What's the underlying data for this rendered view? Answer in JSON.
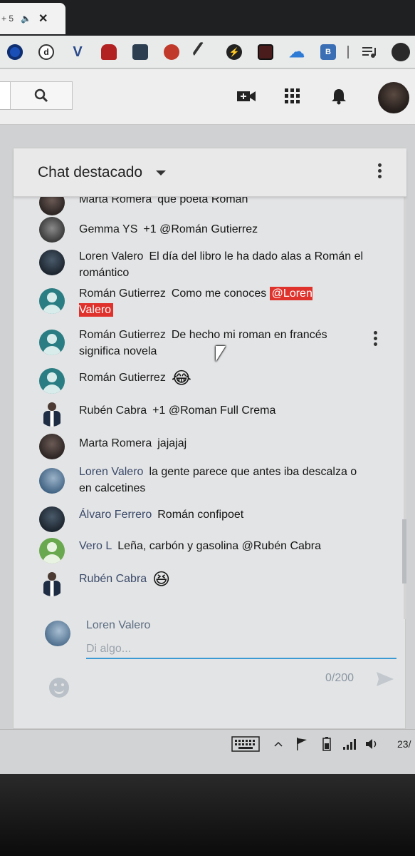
{
  "browser": {
    "tab": {
      "title": "+ 5",
      "sound_icon": "🔈",
      "close_icon": "✕"
    },
    "extensions": [
      {
        "name": "circle-blue-extension-icon",
        "label": "",
        "color": "#1a4fb8"
      },
      {
        "name": "d-extension-icon",
        "label": "d",
        "color": "#3a3a3a"
      },
      {
        "name": "v-extension-icon",
        "label": "V",
        "color": "#2b4b8a"
      },
      {
        "name": "lock-red-extension-icon",
        "label": "",
        "color": "#b22222"
      },
      {
        "name": "printer-extension-icon",
        "label": "",
        "color": "#2c3e50"
      },
      {
        "name": "bug-extension-icon",
        "label": "",
        "color": "#c0392b"
      },
      {
        "name": "pencil-extension-icon",
        "label": "",
        "color": "#333333"
      },
      {
        "name": "bolt-extension-icon",
        "label": "⚡",
        "color": "#222222"
      },
      {
        "name": "dark-square-extension-icon",
        "label": "",
        "color": "#4a1c1c"
      },
      {
        "name": "cloud-extension-icon",
        "label": "☁",
        "color": "#2e7bd6"
      },
      {
        "name": "b-extension-icon",
        "label": "B",
        "color": "#3b6fb5"
      },
      {
        "name": "playlist-extension-icon",
        "label": "",
        "color": "#333333"
      },
      {
        "name": "account-circle-icon",
        "label": "",
        "color": "#2a2a2a"
      }
    ]
  },
  "header": {
    "search_icon": "search-icon",
    "create_icon": "video-plus-icon",
    "apps_icon": "apps-grid-icon",
    "notifications_icon": "bell-icon"
  },
  "chat": {
    "title": "Chat destacado",
    "partial_top": {
      "author": "Marta Romera",
      "text": "que poeta Román"
    },
    "messages": [
      {
        "author": "Gemma YS",
        "text": "+1 @Román Gutierrez"
      },
      {
        "author": "Loren Valero",
        "text": "El día del libro le ha dado alas a Román el romántico"
      },
      {
        "author": "Román Gutierrez",
        "text": "Como me conoces ",
        "mention": "@Loren Valero"
      },
      {
        "author": "Román Gutierrez",
        "text": "De hecho mi roman en francés significa novela"
      },
      {
        "author": "Román Gutierrez",
        "text": "",
        "emoji": "😂"
      },
      {
        "author": "Rubén Cabra",
        "text": "+1 @Roman Full Crema"
      },
      {
        "author": "Marta Romera",
        "text": "jajajaj"
      },
      {
        "author": "Loren Valero",
        "text": "la gente parece que antes iba descalza o en calcetines"
      },
      {
        "author": "Álvaro Ferrero",
        "text": "Román confipoet"
      },
      {
        "author": "Vero L",
        "text": "Leña, carbón y gasolina @Rubén Cabra"
      },
      {
        "author": "Rubén Cabra",
        "text": "",
        "emoji": "😆"
      }
    ],
    "composer": {
      "user": "Loren Valero",
      "placeholder": "Di algo...",
      "counter": "0/200"
    }
  },
  "taskbar": {
    "time": "23/"
  },
  "colors": {
    "mention_bg": "#e0322c",
    "input_underline": "#3b9ad4",
    "default_avatar": "#2a7d82"
  }
}
